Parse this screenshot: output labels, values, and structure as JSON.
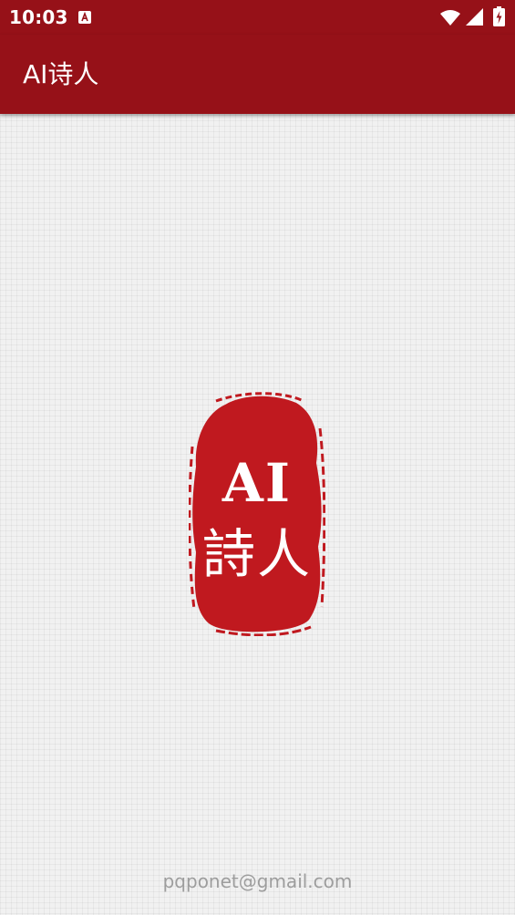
{
  "status_bar": {
    "time": "10:03",
    "icons": [
      "app-notification-icon",
      "wifi-icon",
      "cell-signal-icon",
      "battery-charging-icon"
    ]
  },
  "app_bar": {
    "title": "AI诗人",
    "background_color": "#961118"
  },
  "seal_logo": {
    "text_line1": "AI",
    "text_line2": "詩人",
    "color": "#c0191f"
  },
  "footer": {
    "email": "pqponet@gmail.com"
  }
}
